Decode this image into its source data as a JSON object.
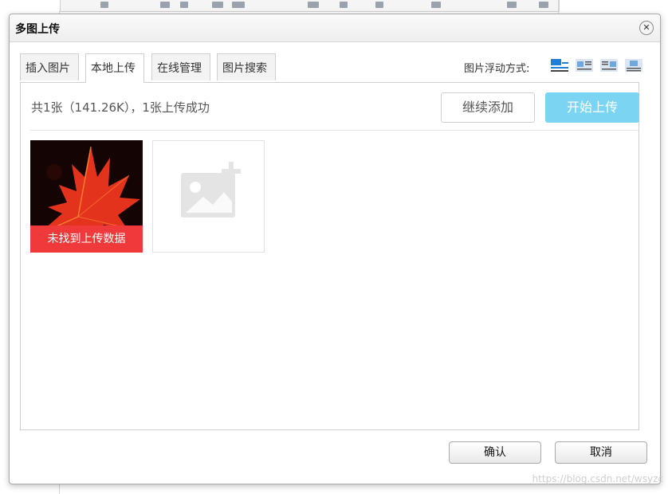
{
  "dialog": {
    "title": "多图上传",
    "close_symbol": "✕"
  },
  "tabs": [
    {
      "label": "插入图片"
    },
    {
      "label": "本地上传"
    },
    {
      "label": "在线管理"
    },
    {
      "label": "图片搜索"
    }
  ],
  "float": {
    "label": "图片浮动方式:",
    "icons": [
      "align-none-icon",
      "align-left-icon",
      "align-right-icon",
      "align-center-icon"
    ]
  },
  "upload": {
    "status": "共1张（141.26K），1张上传成功",
    "continue_label": "继续添加",
    "start_label": "开始上传",
    "error_text": "未找到上传数据"
  },
  "footer": {
    "ok_label": "确认",
    "cancel_label": "取消"
  },
  "watermark": "https://blog.csdn.net/wsyzc",
  "colors": {
    "start_button": "#7bd5f2",
    "error_banner": "#f0393a",
    "float_icon_blue": "#1f7fd6"
  }
}
